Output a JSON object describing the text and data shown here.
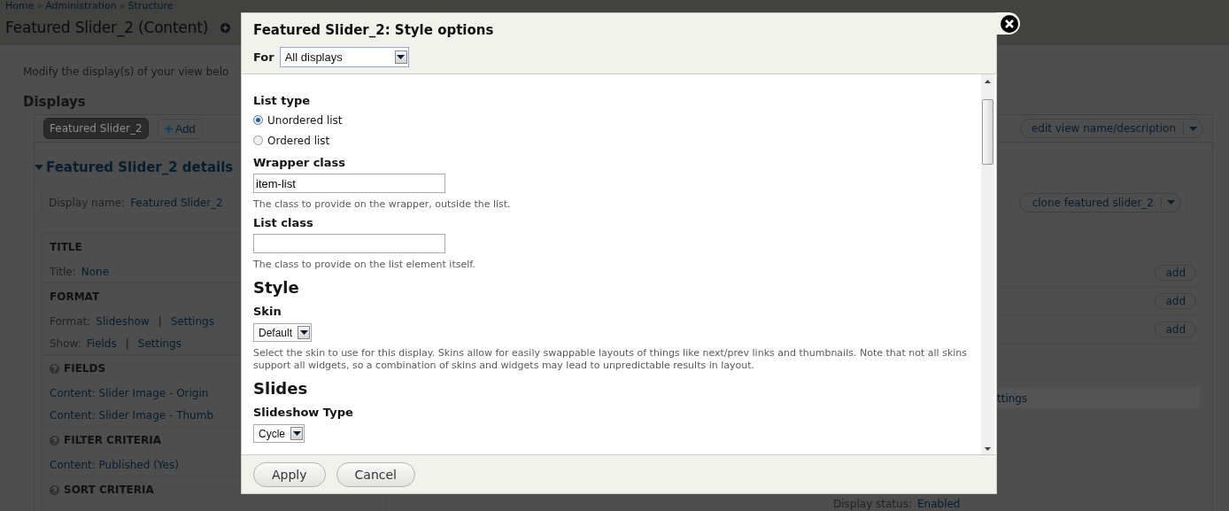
{
  "breadcrumb": {
    "separator": "»",
    "items": [
      {
        "label": "Home"
      },
      {
        "label": "Administration"
      },
      {
        "label": "Structure"
      }
    ]
  },
  "page_title": "Featured Slider_2 (Content)",
  "intro": "Modify the display(s) of your view belo",
  "displays": {
    "heading": "Displays",
    "tabs": [
      {
        "label": "Featured Slider_2",
        "selected": true
      }
    ],
    "add_button": "Add",
    "menu_button": "edit view name/description"
  },
  "details": {
    "heading": "Featured Slider_2 details",
    "expanded": true,
    "display_name_label": "Display name:",
    "display_name": "Featured Slider_2",
    "clone_button": "clone featured slider_2"
  },
  "left_column": [
    {
      "kind": "heading",
      "text": "TITLE",
      "help": false
    },
    {
      "kind": "row",
      "label": "Title:",
      "links": [
        "None"
      ]
    },
    {
      "kind": "heading",
      "text": "FORMAT",
      "help": false
    },
    {
      "kind": "row",
      "label": "Format:",
      "links": [
        "Slideshow",
        "Settings"
      ],
      "separator": "|"
    },
    {
      "kind": "row",
      "label": "Show:",
      "links": [
        "Fields",
        "Settings"
      ],
      "separator": "|"
    },
    {
      "kind": "heading",
      "text": "FIELDS",
      "help": true
    },
    {
      "kind": "row",
      "links": [
        "Content: Slider Image - Origin"
      ]
    },
    {
      "kind": "row",
      "links": [
        "Content: Slider Image - Thumb"
      ]
    },
    {
      "kind": "heading",
      "text": "FILTER CRITERIA",
      "help": true
    },
    {
      "kind": "row",
      "links": [
        "Content: Published (Yes)"
      ]
    },
    {
      "kind": "heading",
      "text": "SORT CRITERIA",
      "help": true
    }
  ],
  "right_column": [
    {
      "kind": "add",
      "label": "add"
    },
    {
      "kind": "add",
      "label": "add"
    },
    {
      "kind": "add",
      "label": "add"
    },
    {
      "kind": "link",
      "text": "ttings"
    },
    {
      "kind": "status",
      "label": "Display status:",
      "value": "Enabled"
    }
  ],
  "modal": {
    "title": "Featured Slider_2: Style options",
    "for_label": "For",
    "for_value": "All displays",
    "fields": [
      {
        "kind": "label",
        "text": "List type"
      },
      {
        "kind": "radio",
        "label": "Unordered list",
        "selected": true
      },
      {
        "kind": "radio",
        "label": "Ordered list",
        "selected": false
      },
      {
        "kind": "label",
        "text": "Wrapper class"
      },
      {
        "kind": "text",
        "value": "item-list"
      },
      {
        "kind": "description",
        "text": "The class to provide on the wrapper, outside the list."
      },
      {
        "kind": "label",
        "text": "List class"
      },
      {
        "kind": "text"
      },
      {
        "kind": "description",
        "text": "The class to provide on the list element itself."
      },
      {
        "kind": "heading",
        "text": "Style"
      },
      {
        "kind": "label",
        "text": "Skin"
      },
      {
        "kind": "select",
        "value": "Default"
      },
      {
        "kind": "description",
        "text": "Select the skin to use for this display. Skins allow for easily swappable layouts of things like next/prev links and thumbnails. Note that not all skins support all widgets, so a combination of skins and widgets may lead to unpredictable results in layout."
      },
      {
        "kind": "heading",
        "text": "Slides"
      },
      {
        "kind": "label",
        "text": "Slideshow Type"
      },
      {
        "kind": "select",
        "value": "Cycle"
      }
    ],
    "buttons": [
      "Apply",
      "Cancel"
    ]
  }
}
